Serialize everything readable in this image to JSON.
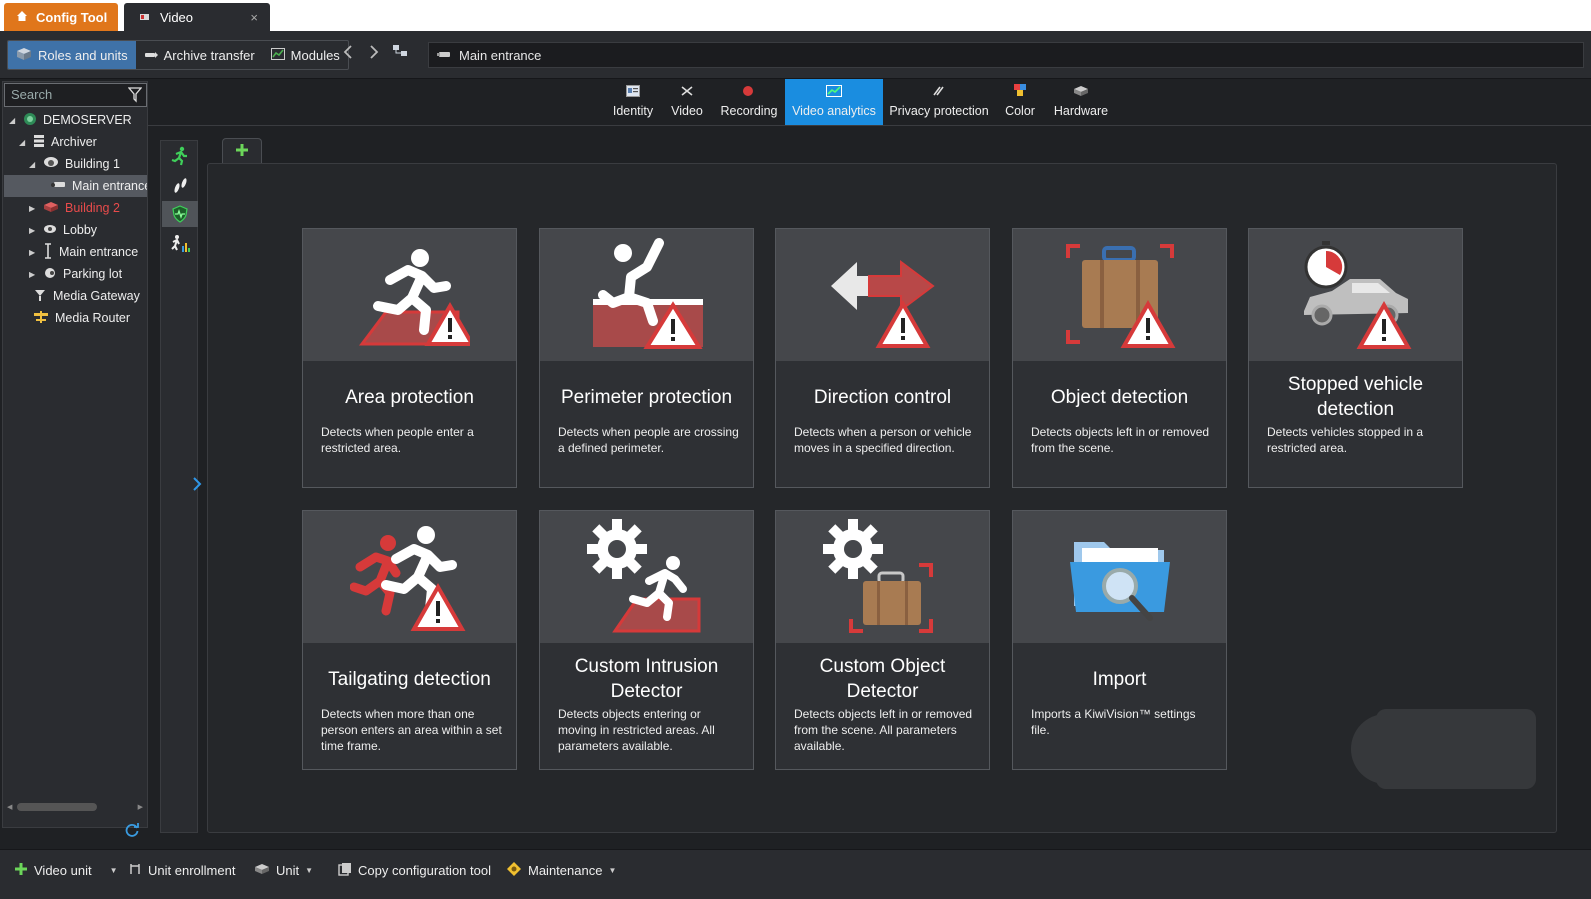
{
  "title_tabs": {
    "config_tool": "Config Tool",
    "video": "Video",
    "close": "×"
  },
  "toolbar": {
    "roles_and_units": "Roles and units",
    "archive_transfer": "Archive transfer",
    "modules": "Modules",
    "address": "Main entrance"
  },
  "sidebar": {
    "search_placeholder": "Search",
    "items": [
      {
        "label": "DEMOSERVER"
      },
      {
        "label": "Archiver"
      },
      {
        "label": "Building 1"
      },
      {
        "label": "Main entrance"
      },
      {
        "label": "Building 2"
      },
      {
        "label": "Lobby"
      },
      {
        "label": "Main entrance"
      },
      {
        "label": "Parking lot"
      },
      {
        "label": "Media Gateway"
      },
      {
        "label": "Media Router"
      }
    ]
  },
  "tabs": [
    {
      "label": "Identity"
    },
    {
      "label": "Video"
    },
    {
      "label": "Recording"
    },
    {
      "label": "Video analytics"
    },
    {
      "label": "Privacy protection"
    },
    {
      "label": "Color"
    },
    {
      "label": "Hardware"
    }
  ],
  "cards": [
    {
      "title": "Area protection",
      "desc": "Detects when people enter a restricted area."
    },
    {
      "title": "Perimeter protection",
      "desc": "Detects when people are crossing a defined perimeter."
    },
    {
      "title": "Direction control",
      "desc": "Detects when a person or vehicle moves in a specified direction."
    },
    {
      "title": "Object detection",
      "desc": "Detects objects left in or removed from the scene."
    },
    {
      "title": "Stopped vehicle detection",
      "desc": "Detects vehicles stopped in a restricted area."
    },
    {
      "title": "Tailgating detection",
      "desc": "Detects when more than one person enters an area within a set time frame."
    },
    {
      "title": "Custom Intrusion Detector",
      "desc": "Detects objects entering or moving in restricted areas. All parameters available."
    },
    {
      "title": "Custom Object Detector",
      "desc": "Detects objects left in or removed from the scene. All parameters available."
    },
    {
      "title": "Import",
      "desc": "Imports a KiwiVision™ settings file."
    }
  ],
  "bottombar": {
    "video_unit": "Video unit",
    "unit_enrollment": "Unit enrollment",
    "unit": "Unit",
    "copy_config": "Copy configuration tool",
    "maintenance": "Maintenance"
  },
  "colors": {
    "accent": "#1a8de0",
    "config_tab": "#e0761b",
    "warning_red": "#d63a3a"
  }
}
